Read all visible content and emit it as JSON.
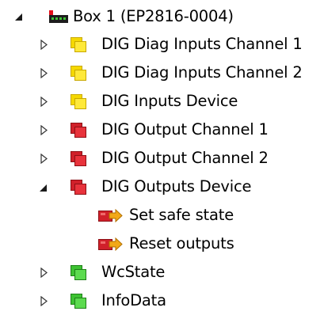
{
  "tree": {
    "root": {
      "label": "Box 1 (EP2816-0004)",
      "expanded": true,
      "icon": "ethercat-box-icon",
      "children": [
        {
          "label": "DIG Diag Inputs Channel 1",
          "icon": "input-module-icon",
          "color": "#F5D800",
          "expanded": false
        },
        {
          "label": "DIG Diag Inputs Channel 2",
          "icon": "input-module-icon",
          "color": "#F5D800",
          "expanded": false
        },
        {
          "label": "DIG Inputs Device",
          "icon": "input-module-icon",
          "color": "#F5D800",
          "expanded": false
        },
        {
          "label": "DIG Output Channel 1",
          "icon": "output-module-icon",
          "color": "#D0202A",
          "expanded": false
        },
        {
          "label": "DIG Output Channel 2",
          "icon": "output-module-icon",
          "color": "#D0202A",
          "expanded": false
        },
        {
          "label": "DIG Outputs Device",
          "icon": "output-module-icon",
          "color": "#D0202A",
          "expanded": true,
          "children": [
            {
              "label": "Set safe state",
              "icon": "output-variable-icon",
              "color": "#D0202A"
            },
            {
              "label": "Reset outputs",
              "icon": "output-variable-icon",
              "color": "#D0202A"
            }
          ]
        },
        {
          "label": "WcState",
          "icon": "status-module-icon",
          "color": "#3DC232",
          "expanded": false
        },
        {
          "label": "InfoData",
          "icon": "status-module-icon",
          "color": "#3DC232",
          "expanded": false
        }
      ]
    }
  }
}
